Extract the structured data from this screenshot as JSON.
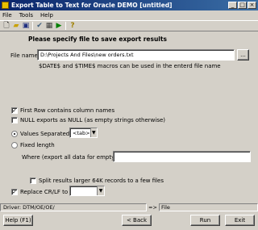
{
  "window": {
    "title": "Export Table to Text for Oracle DEMO [untitled]"
  },
  "menu": [
    "File",
    "Tools",
    "Help"
  ],
  "header": "Please specify file to save export results",
  "file": {
    "label": "File name",
    "value": "D:\\Projects And Files\\new orders.txt",
    "browse": "...",
    "hint": "$DATE$ and $TIME$ macros can be used in the enterd file name"
  },
  "options": {
    "first_row": {
      "label": "First Row contains column names",
      "checked": true
    },
    "null_exports": {
      "label": "NULL exports as NULL (as empty strings otherwise)",
      "checked": false
    },
    "separated": {
      "label": "Values Separated by",
      "value": "<tab>",
      "selected": true
    },
    "fixed_length": {
      "label": "Fixed length",
      "selected": false
    },
    "where": {
      "label": "Where (export all data for empty)",
      "value": ""
    },
    "split": {
      "label": "Split results larger 64K records to a few files",
      "checked": false
    },
    "replace_crlf": {
      "label": "Replace CR/LF to",
      "checked": true,
      "value": ""
    }
  },
  "status": {
    "driver": "Driver: DTM/OE/OE/",
    "arrows": "=>",
    "target": "File"
  },
  "buttons": {
    "help": "Help (F1)",
    "back": "< Back",
    "run": "Run",
    "exit": "Exit"
  }
}
